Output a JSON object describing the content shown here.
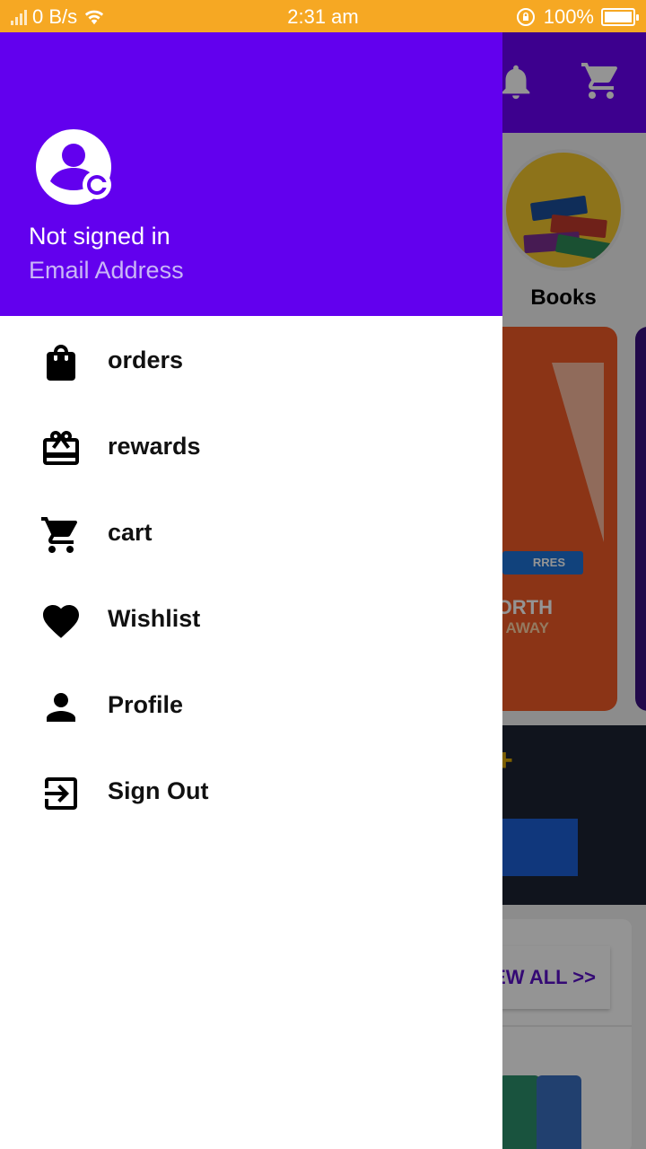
{
  "status_bar": {
    "speed": "0 B/s",
    "time": "2:31 am",
    "battery": "100%"
  },
  "background": {
    "category_label": "Books",
    "banner_tag": "RRES",
    "banner_line1": "ORTH",
    "banner_line2": "AWAY",
    "view_all": "EW ALL >>",
    "accent_color": "#6200ee"
  },
  "drawer": {
    "header": {
      "name": "Not signed in",
      "email": "Email Address"
    },
    "items": [
      {
        "label": "orders",
        "icon": "shopping-bag-icon"
      },
      {
        "label": "rewards",
        "icon": "gift-card-icon"
      },
      {
        "label": "cart",
        "icon": "cart-icon"
      },
      {
        "label": "Wishlist",
        "icon": "heart-icon"
      },
      {
        "label": "Profile",
        "icon": "person-icon"
      },
      {
        "label": "Sign Out",
        "icon": "exit-icon"
      }
    ]
  }
}
